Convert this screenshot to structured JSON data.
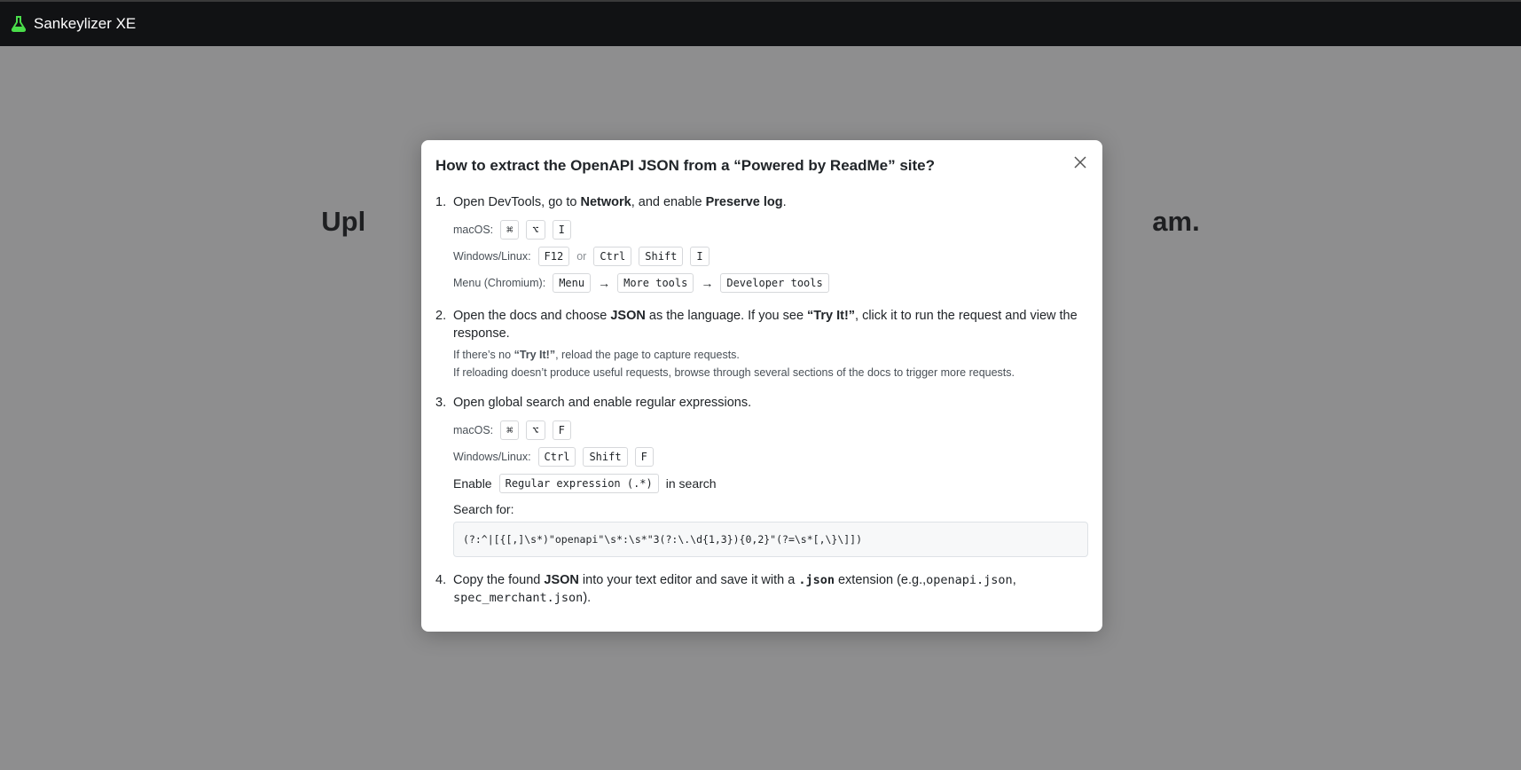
{
  "app": {
    "title": "Sankeylizer XE",
    "logo_icon": "flask-icon",
    "logo_color": "#4ade4a"
  },
  "background": {
    "heading": "Upl                                                                                                       am."
  },
  "modal": {
    "title": "How to extract the OpenAPI JSON from a “Powered by ReadMe” site?",
    "close_icon": "close-icon",
    "step1": {
      "num": "1.",
      "text_a": "Open DevTools, go to ",
      "network": "Network",
      "text_b": ", and enable ",
      "preserve": "Preserve log",
      "text_c": ".",
      "mac_label": "macOS:",
      "mac_keys": [
        "⌘",
        "⌥",
        "I"
      ],
      "win_label": "Windows/Linux:",
      "win_key_f12": "F12",
      "or": "or",
      "win_keys": [
        "Ctrl",
        "Shift",
        "I"
      ],
      "menu_label": "Menu (Chromium):",
      "menu_keys": [
        "Menu",
        "More tools",
        "Developer tools"
      ],
      "arrow": "→"
    },
    "step2": {
      "num": "2.",
      "text_a": "Open the docs and choose ",
      "json": "JSON",
      "text_b": " as the language. If you see ",
      "try": "“Try It!”",
      "text_c": ", click it to run the request and view the response.",
      "note1_a": "If there’s no ",
      "note1_try": "“Try It!”",
      "note1_b": ", reload the page to capture requests.",
      "note2": "If reloading doesn’t produce useful requests, browse through several sections of the docs to trigger more requests."
    },
    "step3": {
      "num": "3.",
      "text": "Open global search and enable regular expressions.",
      "mac_label": "macOS:",
      "mac_keys": [
        "⌘",
        "⌥",
        "F"
      ],
      "win_label": "Windows/Linux:",
      "win_keys": [
        "Ctrl",
        "Shift",
        "F"
      ],
      "enable": "Enable",
      "regex_toggle": "Regular expression (.*)",
      "in_search": "in search",
      "search_for": "Search for:",
      "regex": "(?:^|[{[,]\\s*)\"openapi\"\\s*:\\s*\"3(?:\\.\\d{1,3}){0,2}\"(?=\\s*[,\\}\\]])"
    },
    "step4": {
      "num": "4.",
      "text_a": "Copy the found ",
      "json": "JSON",
      "text_b": " into your text editor and save it with a ",
      "ext": ".json",
      "text_c": " extension (e.g.,",
      "ex1": "openapi.json",
      "comma": ",",
      "ex2": "spec_merchant.json",
      "text_d": ")."
    }
  }
}
